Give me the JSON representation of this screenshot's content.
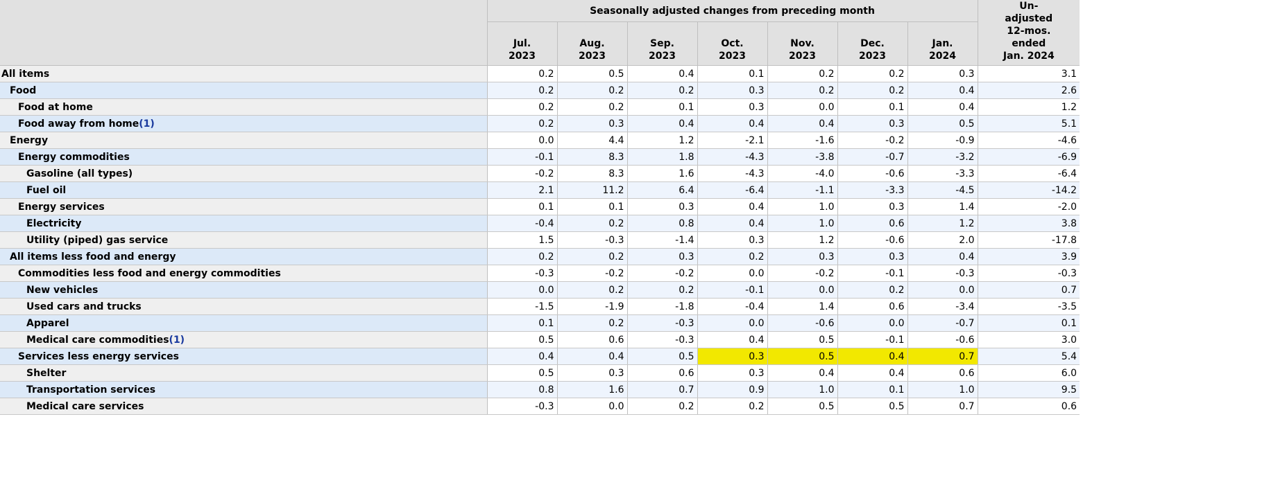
{
  "header": {
    "group_title": "Seasonally adjusted changes from preceding month",
    "months": [
      {
        "line1": "Jul.",
        "line2": "2023"
      },
      {
        "line1": "Aug.",
        "line2": "2023"
      },
      {
        "line1": "Sep.",
        "line2": "2023"
      },
      {
        "line1": "Oct.",
        "line2": "2023"
      },
      {
        "line1": "Nov.",
        "line2": "2023"
      },
      {
        "line1": "Dec.",
        "line2": "2023"
      },
      {
        "line1": "Jan.",
        "line2": "2024"
      }
    ],
    "unadjusted": [
      "Un-",
      "adjusted",
      "12-mos.",
      "ended",
      "Jan. 2024"
    ]
  },
  "rows": [
    {
      "label": "All items",
      "footnote": "",
      "level": 0,
      "values": [
        "0.2",
        "0.5",
        "0.4",
        "0.1",
        "0.2",
        "0.2",
        "0.3",
        "3.1"
      ],
      "highlight": []
    },
    {
      "label": "Food",
      "footnote": "",
      "level": 1,
      "values": [
        "0.2",
        "0.2",
        "0.2",
        "0.3",
        "0.2",
        "0.2",
        "0.4",
        "2.6"
      ],
      "highlight": []
    },
    {
      "label": "Food at home",
      "footnote": "",
      "level": 2,
      "values": [
        "0.2",
        "0.2",
        "0.1",
        "0.3",
        "0.0",
        "0.1",
        "0.4",
        "1.2"
      ],
      "highlight": []
    },
    {
      "label": "Food away from home",
      "footnote": "(1)",
      "level": 2,
      "values": [
        "0.2",
        "0.3",
        "0.4",
        "0.4",
        "0.4",
        "0.3",
        "0.5",
        "5.1"
      ],
      "highlight": []
    },
    {
      "label": "Energy",
      "footnote": "",
      "level": 1,
      "values": [
        "0.0",
        "4.4",
        "1.2",
        "-2.1",
        "-1.6",
        "-0.2",
        "-0.9",
        "-4.6"
      ],
      "highlight": []
    },
    {
      "label": "Energy commodities",
      "footnote": "",
      "level": 2,
      "values": [
        "-0.1",
        "8.3",
        "1.8",
        "-4.3",
        "-3.8",
        "-0.7",
        "-3.2",
        "-6.9"
      ],
      "highlight": []
    },
    {
      "label": "Gasoline (all types)",
      "footnote": "",
      "level": 3,
      "values": [
        "-0.2",
        "8.3",
        "1.6",
        "-4.3",
        "-4.0",
        "-0.6",
        "-3.3",
        "-6.4"
      ],
      "highlight": []
    },
    {
      "label": "Fuel oil",
      "footnote": "",
      "level": 3,
      "values": [
        "2.1",
        "11.2",
        "6.4",
        "-6.4",
        "-1.1",
        "-3.3",
        "-4.5",
        "-14.2"
      ],
      "highlight": []
    },
    {
      "label": "Energy services",
      "footnote": "",
      "level": 2,
      "values": [
        "0.1",
        "0.1",
        "0.3",
        "0.4",
        "1.0",
        "0.3",
        "1.4",
        "-2.0"
      ],
      "highlight": []
    },
    {
      "label": "Electricity",
      "footnote": "",
      "level": 3,
      "values": [
        "-0.4",
        "0.2",
        "0.8",
        "0.4",
        "1.0",
        "0.6",
        "1.2",
        "3.8"
      ],
      "highlight": []
    },
    {
      "label": "Utility (piped) gas service",
      "footnote": "",
      "level": 3,
      "values": [
        "1.5",
        "-0.3",
        "-1.4",
        "0.3",
        "1.2",
        "-0.6",
        "2.0",
        "-17.8"
      ],
      "highlight": []
    },
    {
      "label": "All items less food and energy",
      "footnote": "",
      "level": 1,
      "values": [
        "0.2",
        "0.2",
        "0.3",
        "0.2",
        "0.3",
        "0.3",
        "0.4",
        "3.9"
      ],
      "highlight": []
    },
    {
      "label": "Commodities less food and energy commodities",
      "footnote": "",
      "level": 2,
      "values": [
        "-0.3",
        "-0.2",
        "-0.2",
        "0.0",
        "-0.2",
        "-0.1",
        "-0.3",
        "-0.3"
      ],
      "highlight": []
    },
    {
      "label": "New vehicles",
      "footnote": "",
      "level": 3,
      "values": [
        "0.0",
        "0.2",
        "0.2",
        "-0.1",
        "0.0",
        "0.2",
        "0.0",
        "0.7"
      ],
      "highlight": []
    },
    {
      "label": "Used cars and trucks",
      "footnote": "",
      "level": 3,
      "values": [
        "-1.5",
        "-1.9",
        "-1.8",
        "-0.4",
        "1.4",
        "0.6",
        "-3.4",
        "-3.5"
      ],
      "highlight": []
    },
    {
      "label": "Apparel",
      "footnote": "",
      "level": 3,
      "values": [
        "0.1",
        "0.2",
        "-0.3",
        "0.0",
        "-0.6",
        "0.0",
        "-0.7",
        "0.1"
      ],
      "highlight": []
    },
    {
      "label": "Medical care commodities",
      "footnote": "(1)",
      "level": 3,
      "values": [
        "0.5",
        "0.6",
        "-0.3",
        "0.4",
        "0.5",
        "-0.1",
        "-0.6",
        "3.0"
      ],
      "highlight": []
    },
    {
      "label": "Services less energy services",
      "footnote": "",
      "level": 2,
      "values": [
        "0.4",
        "0.4",
        "0.5",
        "0.3",
        "0.5",
        "0.4",
        "0.7",
        "5.4"
      ],
      "highlight": [
        3,
        4,
        5,
        6
      ]
    },
    {
      "label": "Shelter",
      "footnote": "",
      "level": 3,
      "values": [
        "0.5",
        "0.3",
        "0.6",
        "0.3",
        "0.4",
        "0.4",
        "0.6",
        "6.0"
      ],
      "highlight": []
    },
    {
      "label": "Transportation services",
      "footnote": "",
      "level": 3,
      "values": [
        "0.8",
        "1.6",
        "0.7",
        "0.9",
        "1.0",
        "0.1",
        "1.0",
        "9.5"
      ],
      "highlight": []
    },
    {
      "label": "Medical care services",
      "footnote": "",
      "level": 3,
      "values": [
        "-0.3",
        "0.0",
        "0.2",
        "0.2",
        "0.5",
        "0.5",
        "0.7",
        "0.6"
      ],
      "highlight": []
    }
  ],
  "colors": {
    "highlight": "#f2e800",
    "header_bg": "#e1e1e1",
    "row_label_odd": "#efefef",
    "row_label_even": "#dce9f8",
    "footnote": "#1a3a9e"
  }
}
